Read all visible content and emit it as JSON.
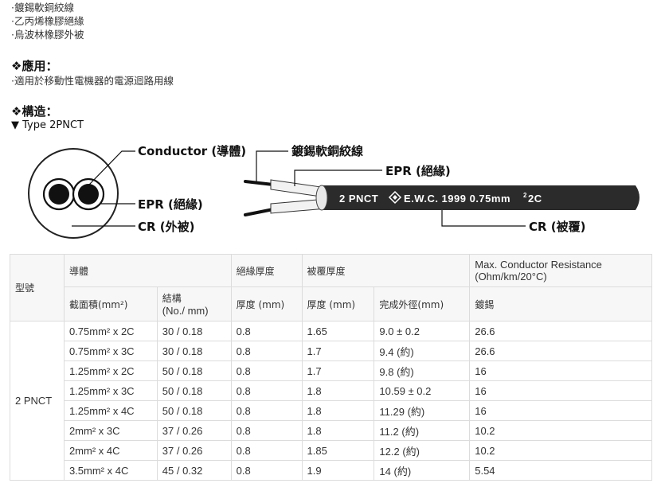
{
  "features": [
    "·鍍錫軟銅絞線",
    "·乙丙烯橡膠絕緣",
    "·烏波林橡膠外被"
  ],
  "application": {
    "title": "❖應用：",
    "text": "·適用於移動性電機器的電源迴路用線"
  },
  "construction": {
    "title": "❖構造：",
    "type_label": "▼ Type 2PNCT"
  },
  "diagram": {
    "conductor_label": "Conductor (導體)",
    "strand_label": "鍍錫軟銅絞線",
    "epr_label_left": "EPR (絕緣)",
    "cr_label_left": "CR (外被)",
    "epr_label_right": "EPR (絕緣)",
    "cr_label_right": "CR (被覆)",
    "print_type": "2 PNCT",
    "print_brand": "E.W.C. 1999  0.75mm",
    "print_sup": "2",
    "print_cores": " 2C",
    "colors": {
      "sheath": "#2b2b2b",
      "insulation": "#f2f2f2",
      "conductor": "#111111"
    }
  },
  "table": {
    "header1": {
      "model": "型號",
      "conductor": "導體",
      "insulation": "絕緣厚度",
      "sheath": "被覆厚度",
      "resistance_line1": "Max. Conductor Resistance",
      "resistance_line2": "(Ohm/km/20°C)"
    },
    "header2": {
      "area": "截面積(mm²)",
      "struct_line1": "結構",
      "struct_line2": "(No./ mm)",
      "ins_thick": "厚度 (mm)",
      "sheath_thick": "厚度 (mm)",
      "od": "完成外徑(mm)",
      "tinned": "鍍錫"
    },
    "model_value": "2 PNCT",
    "rows": [
      [
        "0.75mm² x 2C",
        "30 / 0.18",
        "0.8",
        "1.65",
        "9.0 ± 0.2",
        "26.6"
      ],
      [
        "0.75mm² x 3C",
        "30 / 0.18",
        "0.8",
        "1.7",
        "9.4 (約)",
        "26.6"
      ],
      [
        "1.25mm² x 2C",
        "50 / 0.18",
        "0.8",
        "1.7",
        "9.8 (約)",
        "16"
      ],
      [
        "1.25mm² x 3C",
        "50 / 0.18",
        "0.8",
        "1.8",
        "10.59 ± 0.2",
        "16"
      ],
      [
        "1.25mm² x 4C",
        "50 / 0.18",
        "0.8",
        "1.8",
        "11.29 (約)",
        "16"
      ],
      [
        "2mm² x 3C",
        "37 / 0.26",
        "0.8",
        "1.8",
        "11.2 (約)",
        "10.2"
      ],
      [
        "2mm² x 4C",
        "37 / 0.26",
        "0.8",
        "1.85",
        "12.2 (約)",
        "10.2"
      ],
      [
        "3.5mm² x 4C",
        "45 / 0.32",
        "0.8",
        "1.9",
        "14 (約)",
        "5.54"
      ]
    ]
  }
}
